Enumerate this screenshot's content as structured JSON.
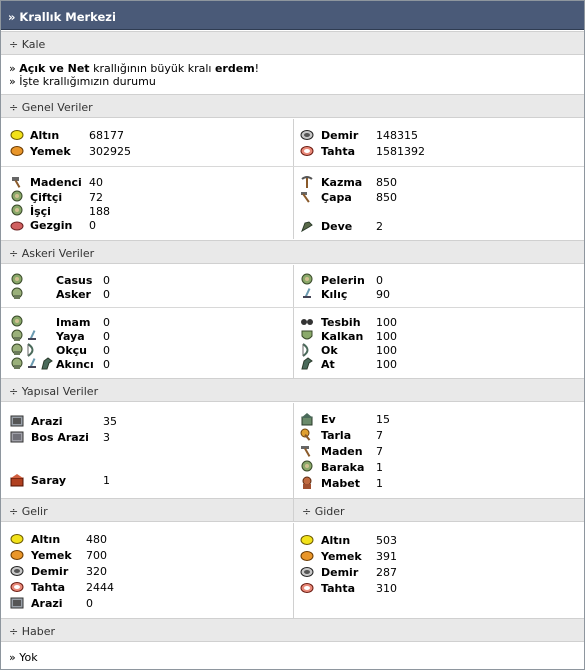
{
  "title": "» Krallık Merkezi",
  "kale": {
    "header": "÷ Kale",
    "line1_prefix": "» ",
    "name": "Açık ve Net",
    "line1_mid": " krallığının büyük kralı ",
    "king": "erdem",
    "line1_suffix": "!",
    "line2": "» İşte krallığımızın durumu"
  },
  "genel": {
    "header": "÷ Genel Veriler",
    "left1": [
      {
        "icon": "gold-coin-icon",
        "label": "Altın",
        "value": "68177"
      },
      {
        "icon": "food-icon",
        "label": "Yemek",
        "value": "302925"
      }
    ],
    "right1": [
      {
        "icon": "iron-icon",
        "label": "Demir",
        "value": "148315"
      },
      {
        "icon": "wood-icon",
        "label": "Tahta",
        "value": "1581392"
      }
    ],
    "left2": [
      {
        "icon": "hammer-icon",
        "label": "Madenci",
        "value": "40"
      },
      {
        "icon": "farmer-icon",
        "label": "Çiftçi",
        "value": "72"
      },
      {
        "icon": "worker-icon",
        "label": "İşçi",
        "value": "188"
      },
      {
        "icon": "explorer-icon",
        "label": "Gezgin",
        "value": "0"
      }
    ],
    "right2": [
      {
        "icon": "pickaxe-icon",
        "label": "Kazma",
        "value": "850"
      },
      {
        "icon": "hoe-icon",
        "label": "Çapa",
        "value": "850"
      },
      {
        "icon": "camel-icon",
        "label": "Deve",
        "value": "2"
      }
    ]
  },
  "askeri": {
    "header": "÷ Askeri Veriler",
    "left1": [
      {
        "icon": "spy-icon",
        "label": "Casus",
        "value": "0"
      },
      {
        "icon": "soldier-icon",
        "label": "Asker",
        "value": "0"
      }
    ],
    "right1": [
      {
        "icon": "cloak-icon",
        "label": "Pelerin",
        "value": "0"
      },
      {
        "icon": "sword-icon",
        "label": "Kılıç",
        "value": "90"
      }
    ],
    "left2": [
      {
        "label": "Imam",
        "value": "0"
      },
      {
        "label": "Yaya",
        "value": "0"
      },
      {
        "label": "Okçu",
        "value": "0"
      },
      {
        "label": "Akıncı",
        "value": "0"
      }
    ],
    "right2": [
      {
        "icon": "prayer-beads-icon",
        "label": "Tesbih",
        "value": "100"
      },
      {
        "icon": "shield-icon",
        "label": "Kalkan",
        "value": "100"
      },
      {
        "icon": "bow-icon",
        "label": "Ok",
        "value": "100"
      },
      {
        "icon": "horse-icon",
        "label": "At",
        "value": "100"
      }
    ]
  },
  "yapisal": {
    "header": "÷ Yapısal Veriler",
    "left": [
      {
        "icon": "land-icon",
        "label": "Arazi",
        "value": "35"
      },
      {
        "icon": "empty-land-icon",
        "label": "Bos Arazi",
        "value": "3"
      },
      {
        "icon": "palace-icon",
        "label": "Saray",
        "value": "1"
      }
    ],
    "right": [
      {
        "icon": "house-icon",
        "label": "Ev",
        "value": "15"
      },
      {
        "icon": "field-icon",
        "label": "Tarla",
        "value": "7"
      },
      {
        "icon": "mine-icon",
        "label": "Maden",
        "value": "7"
      },
      {
        "icon": "barracks-icon",
        "label": "Baraka",
        "value": "1"
      },
      {
        "icon": "temple-icon",
        "label": "Mabet",
        "value": "1"
      }
    ]
  },
  "gelir": {
    "header": "÷ Gelir",
    "rows": [
      {
        "icon": "gold-coin-icon",
        "label": "Altın",
        "value": "480"
      },
      {
        "icon": "food-icon",
        "label": "Yemek",
        "value": "700"
      },
      {
        "icon": "iron-icon",
        "label": "Demir",
        "value": "320"
      },
      {
        "icon": "wood-icon",
        "label": "Tahta",
        "value": "2444"
      },
      {
        "icon": "land-icon",
        "label": "Arazi",
        "value": "0"
      }
    ]
  },
  "gider": {
    "header": "÷ Gider",
    "rows": [
      {
        "icon": "gold-coin-icon",
        "label": "Altın",
        "value": "503"
      },
      {
        "icon": "food-icon",
        "label": "Yemek",
        "value": "391"
      },
      {
        "icon": "iron-icon",
        "label": "Demir",
        "value": "287"
      },
      {
        "icon": "wood-icon",
        "label": "Tahta",
        "value": "310"
      }
    ]
  },
  "haber": {
    "header": "÷ Haber",
    "text": "» Yok"
  },
  "colors": {
    "title_bar": "#4a5a78",
    "section_bg": "#e9e9e9",
    "border": "#d0d0d0"
  }
}
